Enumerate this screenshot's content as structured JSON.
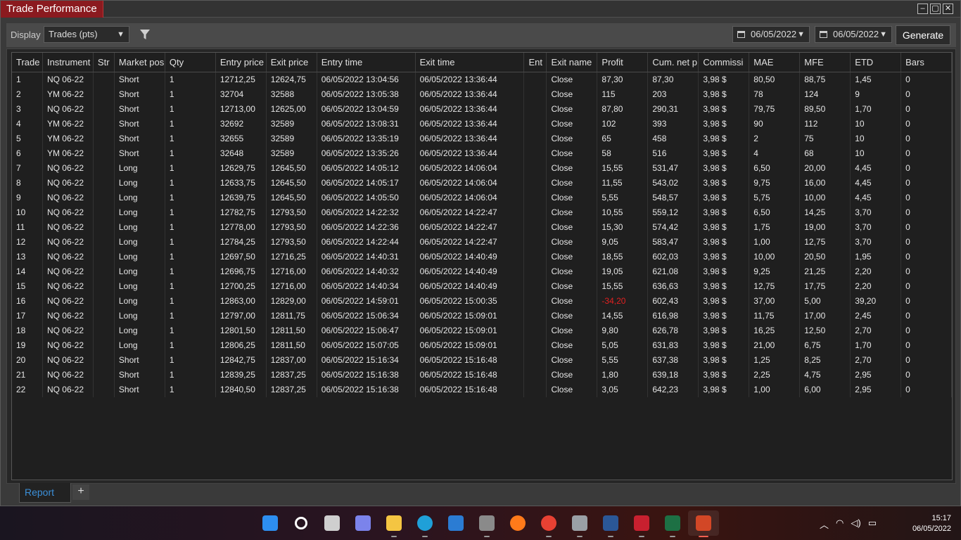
{
  "window": {
    "title": "Trade Performance",
    "controls": [
      "–",
      "▢",
      "✕"
    ]
  },
  "toolbar": {
    "display_label": "Display",
    "display_value": "Trades (pts)",
    "date_from": "06/05/2022",
    "date_to": "06/05/2022",
    "generate_label": "Generate"
  },
  "grid": {
    "columns": [
      "Trade",
      "Instrument",
      "Strategy",
      "Market pos",
      "Qty",
      "Entry price",
      "Exit price",
      "Entry time",
      "Exit time",
      "Entry name",
      "Exit name",
      "Profit",
      "Cum. net p",
      "Commission",
      "MAE",
      "MFE",
      "ETD",
      "Bars"
    ],
    "column_display": [
      "Trade",
      "Instrument",
      "Str",
      "Market pos",
      "Qty",
      "Entry price",
      "Exit price",
      "Entry time",
      "Exit time",
      "Ent",
      "Exit name",
      "Profit",
      "Cum. net p",
      "Commissi",
      "MAE",
      "MFE",
      "ETD",
      "Bars"
    ],
    "rows": [
      [
        "1",
        "NQ 06-22",
        "",
        "Short",
        "1",
        "12712,25",
        "12624,75",
        "06/05/2022 13:04:56",
        "06/05/2022 13:36:44",
        "",
        "Close",
        "87,30",
        "87,30",
        "3,98 $",
        "80,50",
        "88,75",
        "1,45",
        "0"
      ],
      [
        "2",
        "YM 06-22",
        "",
        "Short",
        "1",
        "32704",
        "32588",
        "06/05/2022 13:05:38",
        "06/05/2022 13:36:44",
        "",
        "Close",
        "115",
        "203",
        "3,98 $",
        "78",
        "124",
        "9",
        "0"
      ],
      [
        "3",
        "NQ 06-22",
        "",
        "Short",
        "1",
        "12713,00",
        "12625,00",
        "06/05/2022 13:04:59",
        "06/05/2022 13:36:44",
        "",
        "Close",
        "87,80",
        "290,31",
        "3,98 $",
        "79,75",
        "89,50",
        "1,70",
        "0"
      ],
      [
        "4",
        "YM 06-22",
        "",
        "Short",
        "1",
        "32692",
        "32589",
        "06/05/2022 13:08:31",
        "06/05/2022 13:36:44",
        "",
        "Close",
        "102",
        "393",
        "3,98 $",
        "90",
        "112",
        "10",
        "0"
      ],
      [
        "5",
        "YM 06-22",
        "",
        "Short",
        "1",
        "32655",
        "32589",
        "06/05/2022 13:35:19",
        "06/05/2022 13:36:44",
        "",
        "Close",
        "65",
        "458",
        "3,98 $",
        "2",
        "75",
        "10",
        "0"
      ],
      [
        "6",
        "YM 06-22",
        "",
        "Short",
        "1",
        "32648",
        "32589",
        "06/05/2022 13:35:26",
        "06/05/2022 13:36:44",
        "",
        "Close",
        "58",
        "516",
        "3,98 $",
        "4",
        "68",
        "10",
        "0"
      ],
      [
        "7",
        "NQ 06-22",
        "",
        "Long",
        "1",
        "12629,75",
        "12645,50",
        "06/05/2022 14:05:12",
        "06/05/2022 14:06:04",
        "",
        "Close",
        "15,55",
        "531,47",
        "3,98 $",
        "6,50",
        "20,00",
        "4,45",
        "0"
      ],
      [
        "8",
        "NQ 06-22",
        "",
        "Long",
        "1",
        "12633,75",
        "12645,50",
        "06/05/2022 14:05:17",
        "06/05/2022 14:06:04",
        "",
        "Close",
        "11,55",
        "543,02",
        "3,98 $",
        "9,75",
        "16,00",
        "4,45",
        "0"
      ],
      [
        "9",
        "NQ 06-22",
        "",
        "Long",
        "1",
        "12639,75",
        "12645,50",
        "06/05/2022 14:05:50",
        "06/05/2022 14:06:04",
        "",
        "Close",
        "5,55",
        "548,57",
        "3,98 $",
        "5,75",
        "10,00",
        "4,45",
        "0"
      ],
      [
        "10",
        "NQ 06-22",
        "",
        "Long",
        "1",
        "12782,75",
        "12793,50",
        "06/05/2022 14:22:32",
        "06/05/2022 14:22:47",
        "",
        "Close",
        "10,55",
        "559,12",
        "3,98 $",
        "6,50",
        "14,25",
        "3,70",
        "0"
      ],
      [
        "11",
        "NQ 06-22",
        "",
        "Long",
        "1",
        "12778,00",
        "12793,50",
        "06/05/2022 14:22:36",
        "06/05/2022 14:22:47",
        "",
        "Close",
        "15,30",
        "574,42",
        "3,98 $",
        "1,75",
        "19,00",
        "3,70",
        "0"
      ],
      [
        "12",
        "NQ 06-22",
        "",
        "Long",
        "1",
        "12784,25",
        "12793,50",
        "06/05/2022 14:22:44",
        "06/05/2022 14:22:47",
        "",
        "Close",
        "9,05",
        "583,47",
        "3,98 $",
        "1,00",
        "12,75",
        "3,70",
        "0"
      ],
      [
        "13",
        "NQ 06-22",
        "",
        "Long",
        "1",
        "12697,50",
        "12716,25",
        "06/05/2022 14:40:31",
        "06/05/2022 14:40:49",
        "",
        "Close",
        "18,55",
        "602,03",
        "3,98 $",
        "10,00",
        "20,50",
        "1,95",
        "0"
      ],
      [
        "14",
        "NQ 06-22",
        "",
        "Long",
        "1",
        "12696,75",
        "12716,00",
        "06/05/2022 14:40:32",
        "06/05/2022 14:40:49",
        "",
        "Close",
        "19,05",
        "621,08",
        "3,98 $",
        "9,25",
        "21,25",
        "2,20",
        "0"
      ],
      [
        "15",
        "NQ 06-22",
        "",
        "Long",
        "1",
        "12700,25",
        "12716,00",
        "06/05/2022 14:40:34",
        "06/05/2022 14:40:49",
        "",
        "Close",
        "15,55",
        "636,63",
        "3,98 $",
        "12,75",
        "17,75",
        "2,20",
        "0"
      ],
      [
        "16",
        "NQ 06-22",
        "",
        "Long",
        "1",
        "12863,00",
        "12829,00",
        "06/05/2022 14:59:01",
        "06/05/2022 15:00:35",
        "",
        "Close",
        "-34,20",
        "602,43",
        "3,98 $",
        "37,00",
        "5,00",
        "39,20",
        "0"
      ],
      [
        "17",
        "NQ 06-22",
        "",
        "Long",
        "1",
        "12797,00",
        "12811,75",
        "06/05/2022 15:06:34",
        "06/05/2022 15:09:01",
        "",
        "Close",
        "14,55",
        "616,98",
        "3,98 $",
        "11,75",
        "17,00",
        "2,45",
        "0"
      ],
      [
        "18",
        "NQ 06-22",
        "",
        "Long",
        "1",
        "12801,50",
        "12811,50",
        "06/05/2022 15:06:47",
        "06/05/2022 15:09:01",
        "",
        "Close",
        "9,80",
        "626,78",
        "3,98 $",
        "16,25",
        "12,50",
        "2,70",
        "0"
      ],
      [
        "19",
        "NQ 06-22",
        "",
        "Long",
        "1",
        "12806,25",
        "12811,50",
        "06/05/2022 15:07:05",
        "06/05/2022 15:09:01",
        "",
        "Close",
        "5,05",
        "631,83",
        "3,98 $",
        "21,00",
        "6,75",
        "1,70",
        "0"
      ],
      [
        "20",
        "NQ 06-22",
        "",
        "Short",
        "1",
        "12842,75",
        "12837,00",
        "06/05/2022 15:16:34",
        "06/05/2022 15:16:48",
        "",
        "Close",
        "5,55",
        "637,38",
        "3,98 $",
        "1,25",
        "8,25",
        "2,70",
        "0"
      ],
      [
        "21",
        "NQ 06-22",
        "",
        "Short",
        "1",
        "12839,25",
        "12837,25",
        "06/05/2022 15:16:38",
        "06/05/2022 15:16:48",
        "",
        "Close",
        "1,80",
        "639,18",
        "3,98 $",
        "2,25",
        "4,75",
        "2,95",
        "0"
      ],
      [
        "22",
        "NQ 06-22",
        "",
        "Short",
        "1",
        "12840,50",
        "12837,25",
        "06/05/2022 15:16:38",
        "06/05/2022 15:16:48",
        "",
        "Close",
        "3,05",
        "642,23",
        "3,98 $",
        "1,00",
        "6,00",
        "2,95",
        "0"
      ]
    ]
  },
  "tabs": {
    "report": "Report",
    "add": "+"
  },
  "taskbar": {
    "apps": [
      "windows-start",
      "search",
      "task-view",
      "teams-chat",
      "file-explorer",
      "edge",
      "store",
      "camera",
      "firefox",
      "chrome",
      "calculator",
      "word",
      "ninjatrader",
      "excel",
      "snipping-tool"
    ],
    "app_colors": [
      "#2d8ef0",
      "#ffffff",
      "#cfcfcf",
      "#7b83eb",
      "#f4c542",
      "#1fa0d8",
      "#2b7cd3",
      "#8a8a8a",
      "#ff7a1a",
      "#e84133",
      "#9aa0a6",
      "#2b5797",
      "#c8202f",
      "#1d7044",
      "#d24726"
    ],
    "clock_time": "15:17",
    "clock_date": "06/05/2022"
  },
  "colors": {
    "accent_title": "#8b1a1f",
    "negative": "#e02020",
    "tab_text": "#3b8fd8"
  }
}
